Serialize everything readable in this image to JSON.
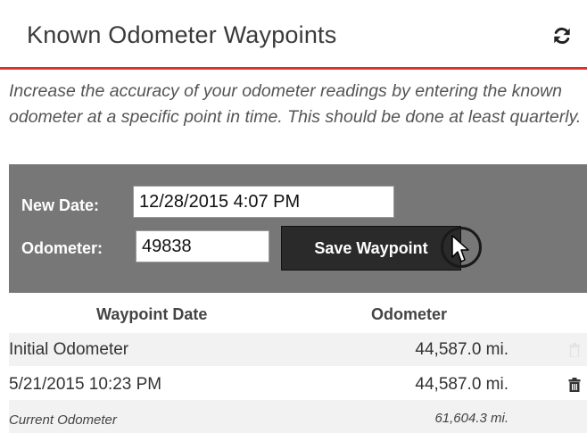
{
  "header": {
    "title": "Known Odometer Waypoints"
  },
  "intro": {
    "text": "Increase the accuracy of your odometer readings by entering the known odometer at a specific point in time. This should be done at least quarterly."
  },
  "form": {
    "date_label": "New Date:",
    "date_value": "12/28/2015 4:07 PM",
    "odometer_label": "Odometer:",
    "odometer_value": "49838",
    "save_label": "Save Waypoint"
  },
  "table": {
    "columns": [
      "Waypoint Date",
      "Odometer"
    ],
    "rows": [
      {
        "date": "Initial Odometer",
        "odometer": "44,587.0 mi.",
        "deletable": false
      },
      {
        "date": "5/21/2015 10:23 PM",
        "odometer": "44,587.0 mi.",
        "deletable": true
      }
    ],
    "footer": {
      "label": "Current Odometer",
      "value": "61,604.3 mi."
    }
  },
  "icons": {
    "refresh": "refresh-icon",
    "delete": "trash-icon",
    "cursor": "mouse-cursor-icon"
  },
  "colors": {
    "accent": "#d9342b",
    "form_bg": "#777777",
    "button_bg": "#2a2a2a",
    "row_shade": "#f2f2f2"
  }
}
